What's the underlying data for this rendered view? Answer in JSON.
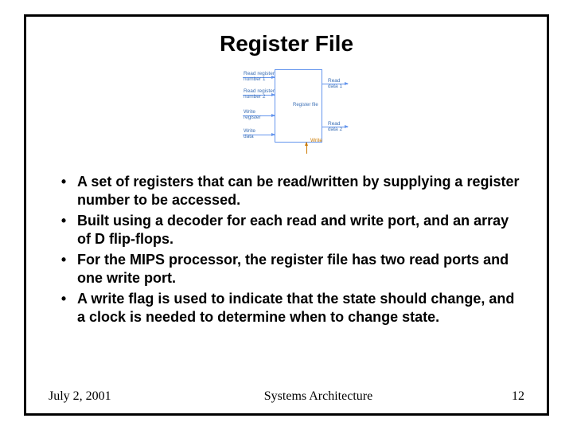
{
  "title": "Register File",
  "diagram": {
    "inputs": [
      {
        "label": "Read register\nnumber 1"
      },
      {
        "label": "Read register\nnumber 2"
      },
      {
        "label": "Write\nregister"
      },
      {
        "label": "Write\ndata"
      }
    ],
    "outputs": [
      {
        "label": "Read\ndata 1"
      },
      {
        "label": "Read\ndata 2"
      }
    ],
    "block_label": "Register file",
    "write_signal": "Write"
  },
  "bullets": [
    "A set of registers that can be read/written by supplying a register number to be accessed.",
    "Built using a decoder for each read and write port, and an array of D flip-flops.",
    "For the MIPS processor, the register file has two read ports and one write port.",
    "A write flag is used to indicate that the state should change, and a clock is needed to determine when to change state."
  ],
  "footer": {
    "date": "July 2, 2001",
    "course": "Systems Architecture",
    "page": "12"
  }
}
